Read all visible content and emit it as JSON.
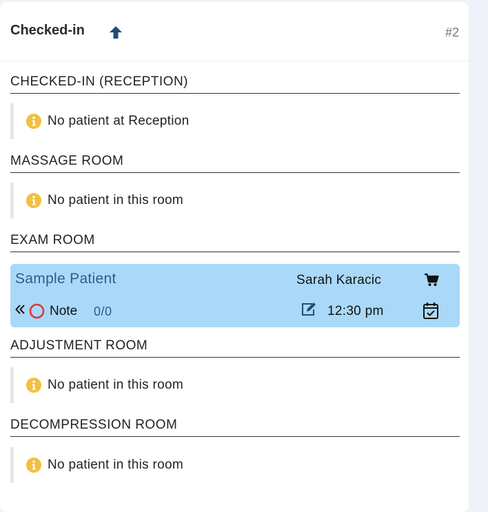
{
  "card": {
    "title": "Checked-in",
    "number": "#2",
    "sort_icon": "arrow-up-icon"
  },
  "sections": [
    {
      "title": "CHECKED-IN (RECEPTION)",
      "empty_text": "No patient at Reception"
    },
    {
      "title": "MASSAGE ROOM",
      "empty_text": "No patient in this room"
    },
    {
      "title": "EXAM ROOM"
    },
    {
      "title": "ADJUSTMENT ROOM",
      "empty_text": "No patient in this room"
    },
    {
      "title": "DECOMPRESSION ROOM",
      "empty_text": "No patient in this room"
    }
  ],
  "patient": {
    "name": "Sample Patient",
    "provider": "Sarah Karacic",
    "note_label": "Note",
    "note_count": "0/0",
    "time": "12:30 pm",
    "card_color": "#aad8f8",
    "name_color": "#2a5f8c"
  },
  "colors": {
    "info_icon": "#f2bf3f",
    "circle_icon": "#d93a3a",
    "primary_dark": "#1f4e79"
  }
}
